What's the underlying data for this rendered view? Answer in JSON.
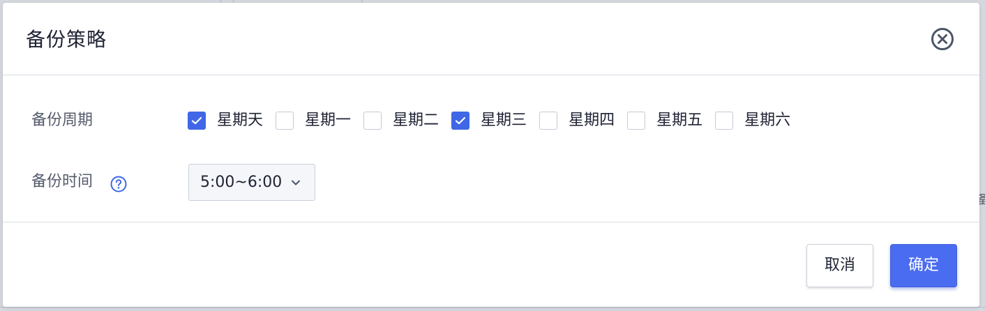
{
  "dialog": {
    "title": "备份策略",
    "close_icon": "close-circle-icon"
  },
  "backup_cycle": {
    "label": "备份周期",
    "days": [
      {
        "label": "星期天",
        "checked": true
      },
      {
        "label": "星期一",
        "checked": false
      },
      {
        "label": "星期二",
        "checked": false
      },
      {
        "label": "星期三",
        "checked": true
      },
      {
        "label": "星期四",
        "checked": false
      },
      {
        "label": "星期五",
        "checked": false
      },
      {
        "label": "星期六",
        "checked": false
      }
    ]
  },
  "backup_time": {
    "label": "备份时间",
    "help_icon": "question-circle-icon",
    "selected": "5:00~6:00"
  },
  "footer": {
    "cancel_label": "取消",
    "confirm_label": "确定"
  },
  "colors": {
    "primary": "#4a6cf0",
    "checkbox_checked": "#3f67e6",
    "text": "#1e2233",
    "label": "#555b6b",
    "help_icon": "#3f67e6"
  }
}
